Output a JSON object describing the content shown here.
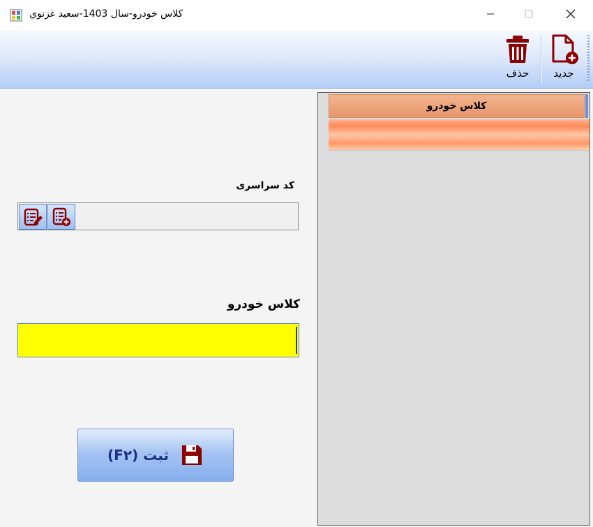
{
  "window": {
    "title": "کلاس خودرو-سال 1403-سعيد غزنوي"
  },
  "toolbar": {
    "new_label": "جديد",
    "delete_label": "حذف"
  },
  "grid": {
    "columns": [
      "کلاس خودرو"
    ],
    "rows": [
      ""
    ]
  },
  "form": {
    "code_label": "کد سراسری",
    "code_value": "",
    "class_label": "کلاس خودرو",
    "class_value": ""
  },
  "save_button": {
    "label": "ثبت (F۲)"
  },
  "colors": {
    "input_highlight": "#ffff00",
    "grid_header": "#e8956a",
    "grid_row_selected": "#ff8a5a",
    "icon_dark_red": "#8b0000",
    "save_text": "#1b2f86"
  },
  "icons": {
    "app": "app-form-icon",
    "new": "new-document-icon",
    "delete": "trash-icon",
    "edit": "list-edit-icon",
    "add": "list-add-icon",
    "save": "floppy-disk-icon"
  }
}
